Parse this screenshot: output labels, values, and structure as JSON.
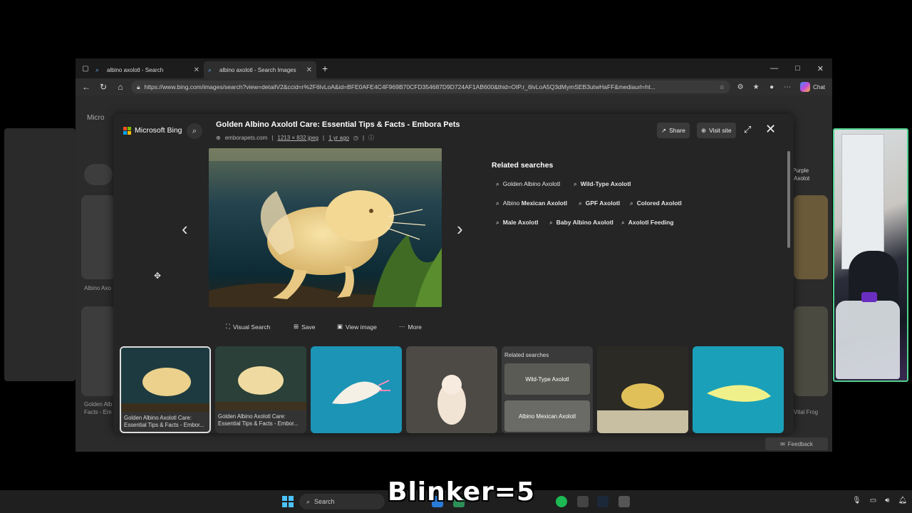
{
  "browser": {
    "tabs": [
      {
        "label": "albino axolotl - Search",
        "active": false
      },
      {
        "label": "albino axolotl - Search Images",
        "active": true
      }
    ],
    "new_tab_label": "+",
    "window_controls": [
      "—",
      "□",
      "✕"
    ],
    "url": "https://www.bing.com/images/search?view=detailV2&ccid=r%2F6lvLoA&id=BFE0AFE4C4F969B70CFD354687D9D724AF1AB600&thid=OIP.r_6lvLoA5Q3dMymSEB3utwHaFF&mediaurl=ht...",
    "chat_label": "Chat"
  },
  "page_background": {
    "left_captions": [
      "Albino Axo",
      "Golden Alb",
      "Facts - Em"
    ],
    "right_captions": [
      "Purple",
      "Axolot",
      "Vital Frog"
    ],
    "feedback_label": "Feedback",
    "header_partial": "Micro"
  },
  "overlay": {
    "brand": "Microsoft Bing",
    "title": "Golden Albino Axolotl Care: Essential Tips & Facts - Embora Pets",
    "source": "emborapets.com",
    "dimensions": "1213 × 832 jpeg",
    "age": "1 yr ago",
    "share_label": "Share",
    "visit_label": "Visit site",
    "related_title": "Related searches",
    "related_chips": [
      {
        "pre": "Golden Albino Axolotl",
        "bold": ""
      },
      {
        "pre": "",
        "bold": "Wild-Type Axolotl"
      },
      {
        "pre": "Albino ",
        "bold": "Mexican Axolotl"
      },
      {
        "pre": "",
        "bold": "GPF Axolotl"
      },
      {
        "pre": "",
        "bold": "Colored Axolotl"
      },
      {
        "pre": "",
        "bold": "Male Axolotl"
      },
      {
        "pre": "",
        "bold": "Baby Albino Axolotl"
      },
      {
        "pre": "",
        "bold": "Axolotl Feeding"
      }
    ],
    "actions": [
      "Visual Search",
      "Save",
      "View image",
      "More"
    ],
    "thumbnails": [
      {
        "caption": "Golden Albino Axolotl Care: Essential Tips & Facts - Embor..."
      },
      {
        "caption": "Golden Albino Axolotl Care: Essential Tips & Facts - Embor..."
      },
      {
        "caption": ""
      },
      {
        "caption": ""
      },
      {
        "caption": "Related searches",
        "items": [
          "Wild-Type Axolotl",
          "Albino Mexican Axolotl"
        ]
      },
      {
        "caption": ""
      },
      {
        "caption": ""
      }
    ]
  },
  "taskbar": {
    "search_label": "Search"
  },
  "overlay_caption": "Blinker=5",
  "colors": {
    "accent": "#4cc2ff",
    "webcam_border": "#4fd18c"
  }
}
